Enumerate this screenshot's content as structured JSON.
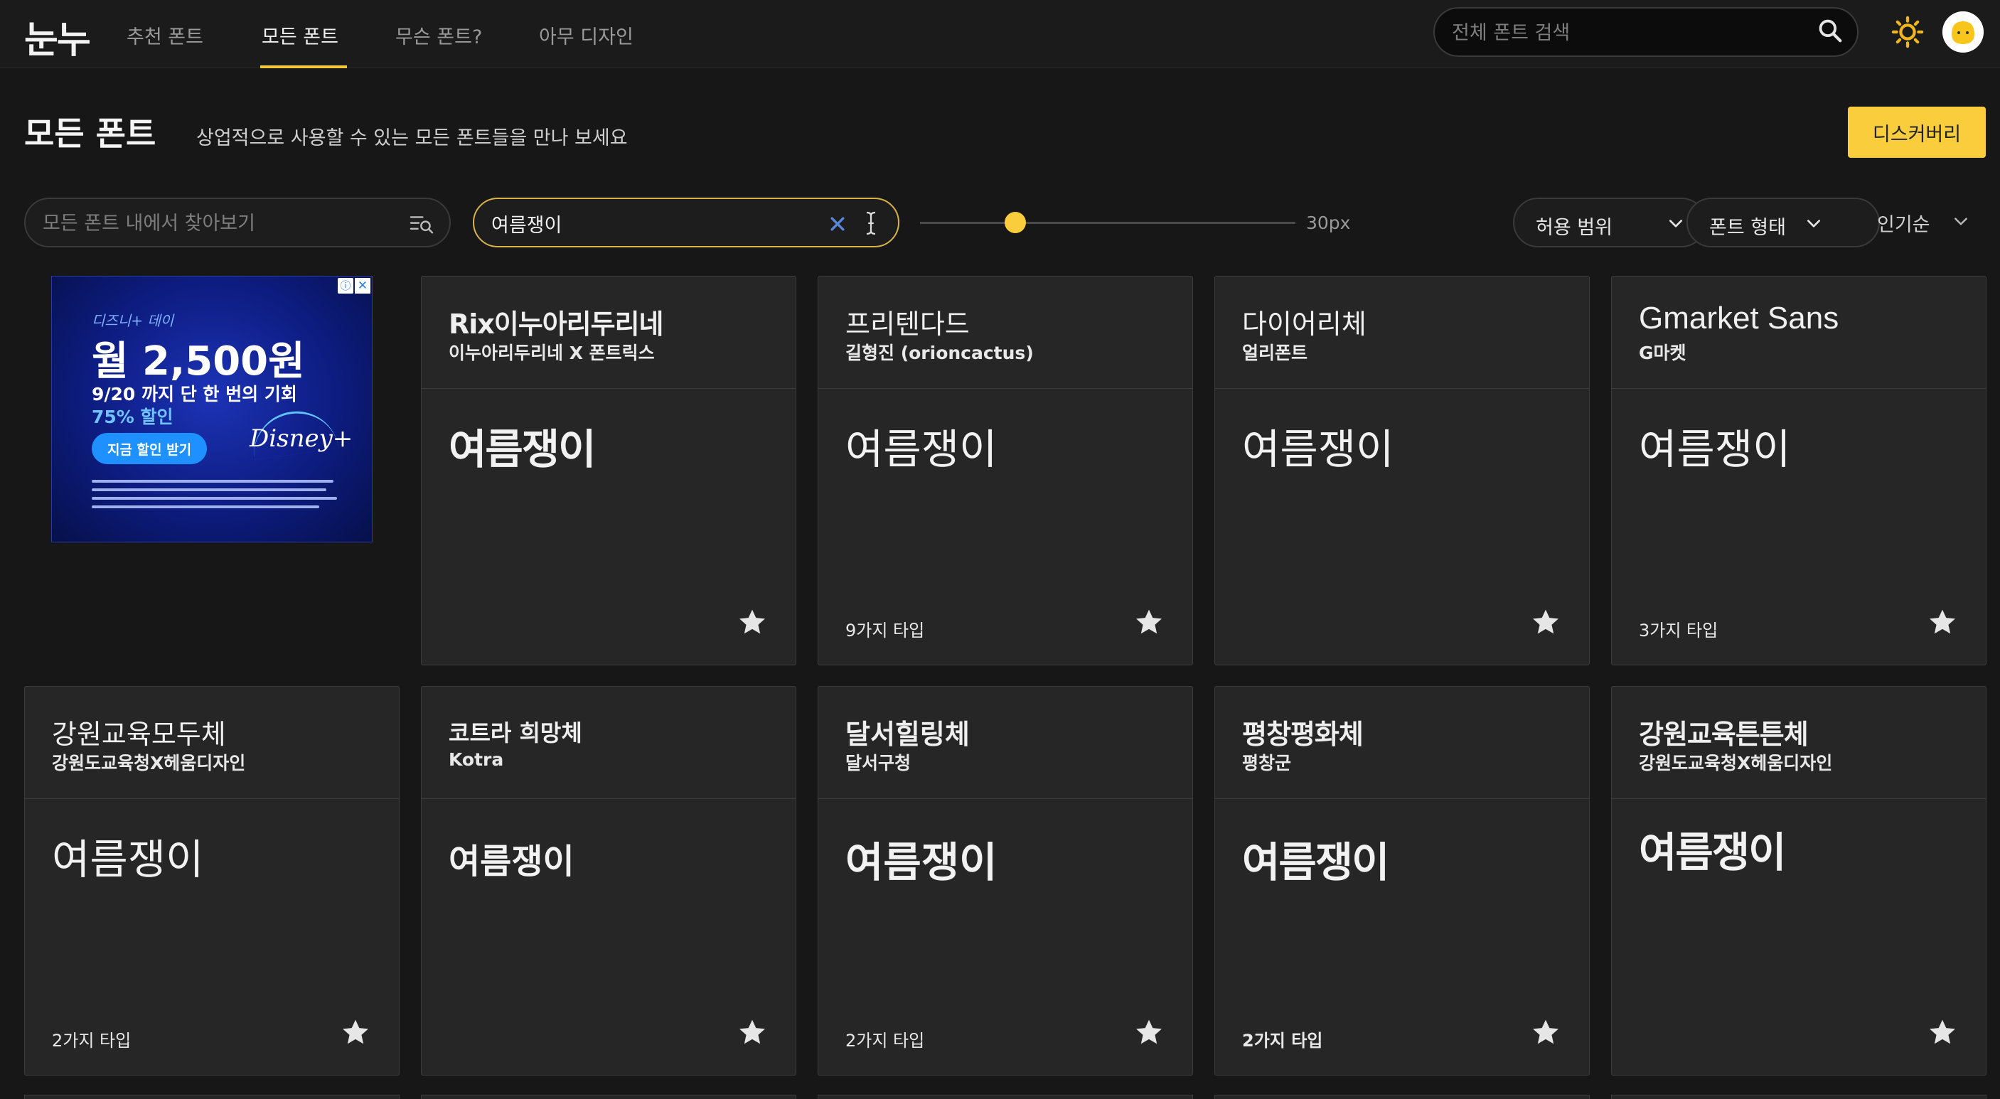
{
  "nav": {
    "logo": "눈누",
    "links": [
      "추천 폰트",
      "모든 폰트",
      "무슨 폰트?",
      "아무 디자인"
    ],
    "active_link": "모든 폰트",
    "search_placeholder": "전체 폰트 검색"
  },
  "header": {
    "title": "모든 폰트",
    "subtitle": "상업적으로 사용할 수 있는 모든 폰트들을 만나 보세요",
    "discovery_button": "디스커버리"
  },
  "filters": {
    "font_search_placeholder": "모든 폰트 내에서 찾아보기",
    "preview_text_value": "여름쟁이",
    "font_size_label": "30px",
    "font_size_px": 30,
    "license_dropdown": "허용 범위",
    "shape_dropdown": "폰트 형태",
    "sort": "인기순"
  },
  "ad": {
    "brand_line": "디즈니+ 데이",
    "price": "월 2,500원",
    "deadline": "9/20 까지 단 한 번의 기회",
    "discount": "75% 할인",
    "cta": "지금 할인 받기",
    "logo": "Disney+"
  },
  "cards": [
    {
      "name": "Rix이누아리두리네",
      "author": "이누아리두리네 X 폰트릭스",
      "preview": "여름쟁이",
      "types": "",
      "style": "heavy"
    },
    {
      "name": "프리텐다드",
      "author": "길형진 (orioncactus)",
      "preview": "여름쟁이",
      "types": "9가지 타입",
      "style": "normal"
    },
    {
      "name": "다이어리체",
      "author": "얼리폰트",
      "preview": "여름쟁이",
      "types": "",
      "style": "normal"
    },
    {
      "name": "Gmarket Sans",
      "author": "G마켓",
      "preview": "여름쟁이",
      "types": "3가지 타입",
      "style": "normal"
    },
    {
      "name": "강원교육모두체",
      "author": "강원도교육청X헤움디자인",
      "preview": "여름쟁이",
      "types": "2가지 타입",
      "style": "normal"
    },
    {
      "name": "코트라 희망체",
      "author": "Kotra",
      "preview": "여름쟁이",
      "types": "",
      "style": "bold"
    },
    {
      "name": "달서힐링체",
      "author": "달서구청",
      "preview": "여름쟁이",
      "types": "2가지 타입",
      "style": "bold"
    },
    {
      "name": "평창평화체",
      "author": "평창군",
      "preview": "여름쟁이",
      "types": "2가지 타입",
      "style": "heavy"
    },
    {
      "name": "강원교육튼튼체",
      "author": "강원도교육청X헤움디자인",
      "preview": "여름쟁이",
      "types": "",
      "style": "heavy"
    }
  ],
  "colors": {
    "accent": "#f9cd3b",
    "background": "#171717",
    "card": "#262626"
  }
}
